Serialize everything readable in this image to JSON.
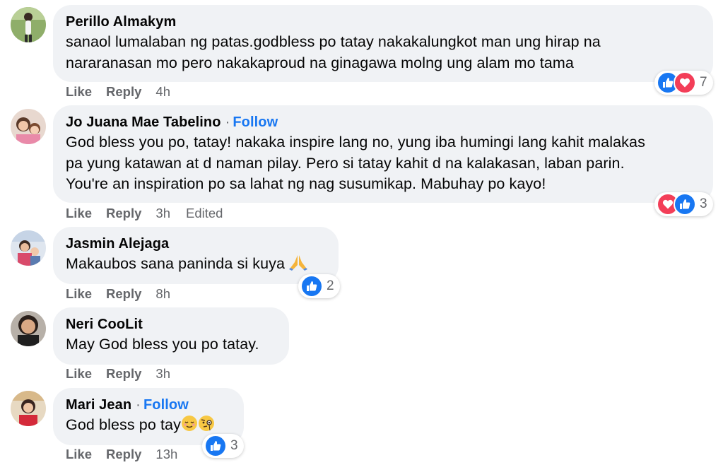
{
  "labels": {
    "like": "Like",
    "reply": "Reply",
    "follow": "Follow",
    "separator": "·"
  },
  "colors": {
    "bubble": "#f0f2f5",
    "link": "#1877f2",
    "like_reaction": "#1877f2",
    "love_reaction": "#f33e58",
    "muted": "#65676b"
  },
  "comments": [
    {
      "author": "Perillo Almakym",
      "follow": false,
      "text": "sanaol lumalaban ng patas.godbless po tatay nakakalungkot man ung hirap na\nnararanasan mo pero nakakaproud na ginagawa molng ung alam mo tama",
      "time": "4h",
      "edited": "",
      "reactions": [
        "like-icon",
        "love-icon"
      ],
      "reaction_count": "7"
    },
    {
      "author": "Jo Juana Mae Tabelino",
      "follow": true,
      "text": "God bless you po, tatay! nakaka inspire lang no, yung iba humingi lang kahit malakas\npa yung katawan at d naman pilay. Pero si tatay kahit d na kalakasan, laban parin.\nYou're an inspiration po sa lahat ng nag susumikap. Mabuhay po kayo!",
      "time": "3h",
      "edited": "Edited",
      "reactions": [
        "love-icon",
        "like-icon"
      ],
      "reaction_count": "3"
    },
    {
      "author": "Jasmin Alejaga",
      "follow": false,
      "text": "Makaubos sana paninda si kuya",
      "text_emoji": [
        "folded-hands-emoji"
      ],
      "time": "8h",
      "edited": "",
      "reactions": [
        "like-icon"
      ],
      "reaction_count": "2"
    },
    {
      "author": "Neri CooLit",
      "follow": false,
      "text": "May God bless you po tatay.",
      "time": "3h",
      "edited": "",
      "reactions": [],
      "reaction_count": ""
    },
    {
      "author": "Mari Jean",
      "follow": true,
      "text": "God bless po tay",
      "text_emoji": [
        "relieved-face-emoji",
        "face-with-monocle-emoji"
      ],
      "time": "13h",
      "edited": "",
      "reactions": [
        "like-icon"
      ],
      "reaction_count": "3"
    }
  ]
}
